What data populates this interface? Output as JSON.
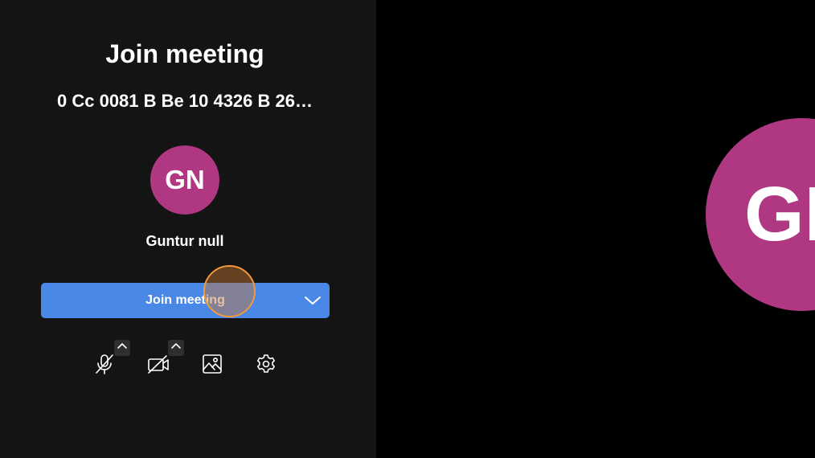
{
  "join_panel": {
    "title": "Join meeting",
    "meeting_id": "0 Cc 0081 B Be 10 4326 B 26…",
    "avatar_initials": "GN",
    "user_name": "Guntur null",
    "join_button_label": "Join meeting",
    "controls": [
      {
        "icon": "microphone-off-icon",
        "has_options": true
      },
      {
        "icon": "camera-off-icon",
        "has_options": true
      },
      {
        "icon": "background-image-icon",
        "has_options": false
      },
      {
        "icon": "gear-icon",
        "has_options": false
      }
    ]
  },
  "preview": {
    "avatar_initials": "GN"
  },
  "colors": {
    "panel_background": "#141414",
    "preview_background": "#000000",
    "avatar": "#b03883",
    "join_button": "#4a88e8",
    "cursor_highlight": "#f29a3a"
  }
}
